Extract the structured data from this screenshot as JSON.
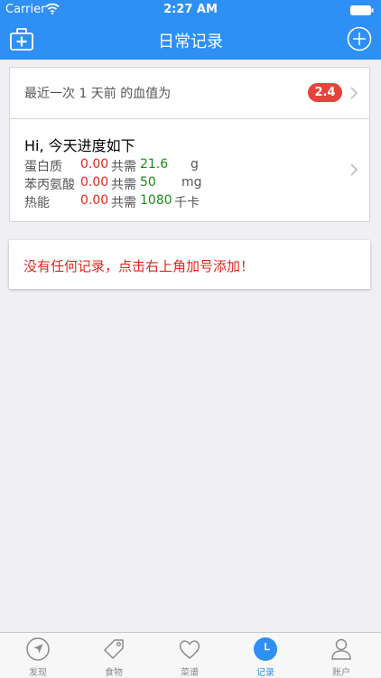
{
  "status_bar": {
    "carrier": "Carrier",
    "time": "2:27 AM"
  },
  "nav": {
    "title": "日常记录",
    "left_icon": "medkit-icon",
    "right_icon": "add-circle-icon"
  },
  "last_blood": {
    "text": "最近一次 1 天前 的血值为",
    "value": "2.4"
  },
  "progress": {
    "greeting": "Hi, 今天进度如下",
    "need_label": "共需",
    "nutrients": [
      {
        "name": "蛋白质",
        "current": "0.00",
        "target": "21.6",
        "unit": "g"
      },
      {
        "name": "苯丙氨酸",
        "current": "0.00",
        "target": "50",
        "unit": "mg"
      },
      {
        "name": "热能",
        "current": "0.00",
        "target": "1080",
        "unit": "千卡"
      }
    ]
  },
  "empty_message": "没有任何记录，点击右上角加号添加！",
  "tabs": [
    {
      "label": "发现",
      "icon": "compass-icon"
    },
    {
      "label": "食物",
      "icon": "tag-icon"
    },
    {
      "label": "菜谱",
      "icon": "heart-icon"
    },
    {
      "label": "记录",
      "icon": "clock-icon",
      "active": true
    },
    {
      "label": "账户",
      "icon": "person-icon"
    }
  ],
  "colors": {
    "nav_blue": "#2e8ff5",
    "badge_red": "#e8423c",
    "current_red": "#e0281e",
    "target_green": "#1a8a1a"
  }
}
